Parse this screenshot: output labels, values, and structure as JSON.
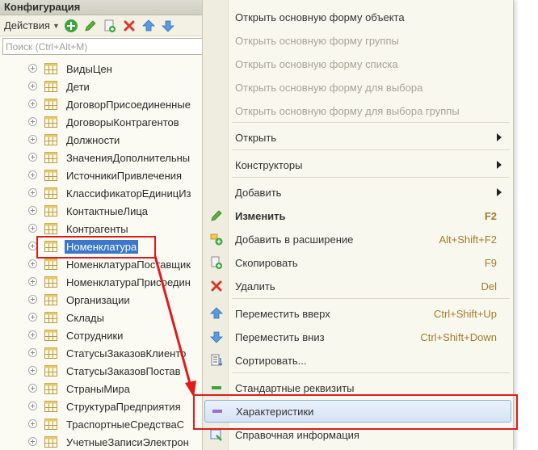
{
  "panel": {
    "title": "Конфигурация",
    "actions_label": "Действия",
    "search_placeholder": "Поиск (Ctrl+Alt+M)"
  },
  "tree": [
    {
      "label": "ВидыЦен"
    },
    {
      "label": "Дети"
    },
    {
      "label": "ДоговорПрисоединенные"
    },
    {
      "label": "ДоговорыКонтрагентов"
    },
    {
      "label": "Должности"
    },
    {
      "label": "ЗначенияДополнительны"
    },
    {
      "label": "ИсточникиПривлечения"
    },
    {
      "label": "КлассификаторЕдиницИз"
    },
    {
      "label": "КонтактныеЛица"
    },
    {
      "label": "Контрагенты"
    },
    {
      "label": "Номенклатура",
      "selected": true
    },
    {
      "label": "НоменклатураПоставщик"
    },
    {
      "label": "НоменклатураПрисоедин"
    },
    {
      "label": "Организации"
    },
    {
      "label": "Склады"
    },
    {
      "label": "Сотрудники"
    },
    {
      "label": "СтатусыЗаказовКлиенто"
    },
    {
      "label": "СтатусыЗаказовПостав"
    },
    {
      "label": "СтраныМира"
    },
    {
      "label": "СтруктураПредприятия"
    },
    {
      "label": "ТраспортныеСредстваС"
    },
    {
      "label": "УчетныеЗаписиЭлектрон"
    }
  ],
  "menu": {
    "items": [
      {
        "label": "Открыть основную форму объекта",
        "disabled": false
      },
      {
        "label": "Открыть основную форму группы",
        "disabled": true
      },
      {
        "label": "Открыть основную форму списка",
        "disabled": true
      },
      {
        "label": "Открыть основную форму для выбора",
        "disabled": true
      },
      {
        "label": "Открыть основную форму для выбора группы",
        "disabled": true
      },
      {
        "label": "Открыть",
        "submenu": true
      },
      {
        "label": "Конструкторы",
        "submenu": true
      },
      {
        "label": "Добавить",
        "submenu": true
      },
      {
        "label": "Изменить",
        "shortcut": "F2",
        "icon": "pencil-icon",
        "bold": true
      },
      {
        "label": "Добавить в расширение",
        "shortcut": "Alt+Shift+F2",
        "icon": "extension-add-icon"
      },
      {
        "label": "Скопировать",
        "shortcut": "F9",
        "icon": "copy-icon"
      },
      {
        "label": "Удалить",
        "shortcut": "Del",
        "icon": "delete-icon"
      },
      {
        "label": "Переместить вверх",
        "shortcut": "Ctrl+Shift+Up",
        "icon": "arrow-up-icon"
      },
      {
        "label": "Переместить вниз",
        "shortcut": "Ctrl+Shift+Down",
        "icon": "arrow-down-icon"
      },
      {
        "label": "Сортировать...",
        "icon": "sort-icon"
      },
      {
        "label": "Стандартные реквизиты",
        "icon": "minus-green-icon"
      },
      {
        "label": "Характеристики",
        "icon": "characteristics-icon",
        "highlighted": true
      },
      {
        "label": "Справочная информация",
        "icon": "help-icon"
      }
    ]
  },
  "colors": {
    "annotation": "#e01b1b",
    "selection": "#3c77c9",
    "shortcut": "#a27b2f"
  }
}
